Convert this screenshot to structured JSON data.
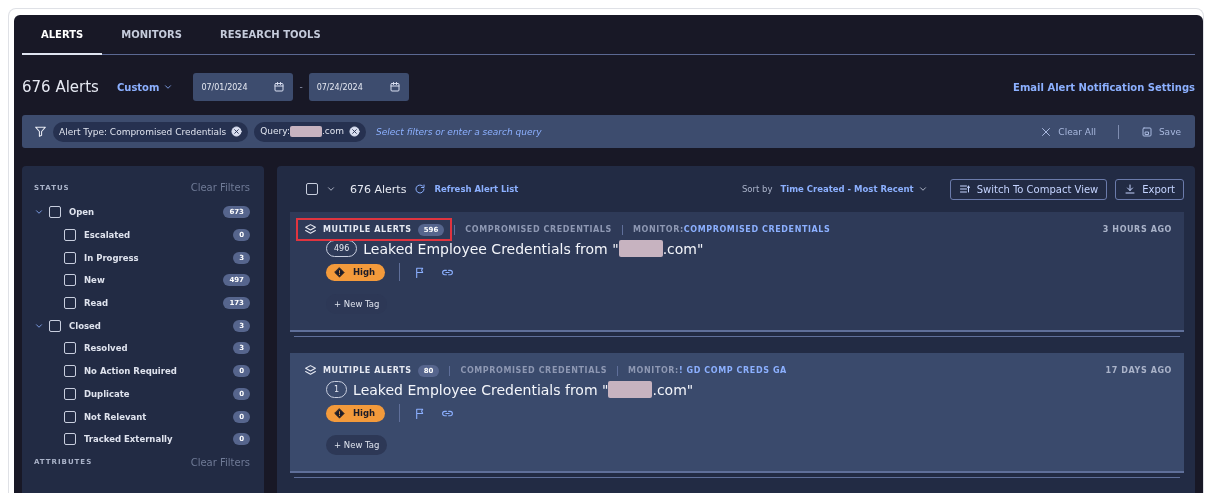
{
  "tabs": [
    {
      "label": "ALERTS",
      "selected": true
    },
    {
      "label": "MONITORS",
      "selected": false
    },
    {
      "label": "RESEARCH TOOLS",
      "selected": false
    }
  ],
  "header": {
    "count": "676 Alerts",
    "range": "Custom",
    "date_from": "07/01/2024",
    "separator": "-",
    "date_to": "07/24/2024",
    "email_link": "Email Alert Notification Settings"
  },
  "filter_bar": {
    "chips": [
      {
        "label": "Alert Type: Compromised Credentials",
        "redacted": false
      },
      {
        "label": "Query:",
        "redacted": true,
        "suffix": ".com"
      }
    ],
    "placeholder": "Select filters or enter a search query",
    "clear": "Clear All",
    "save": "Save"
  },
  "sidebar": {
    "sections": [
      {
        "title": "STATUS",
        "clear": "Clear Filters",
        "groups": [
          {
            "label": "Open",
            "count": "673",
            "expanded": true,
            "checked": false,
            "children": [
              {
                "label": "Escalated",
                "count": "0",
                "checked": false
              },
              {
                "label": "In Progress",
                "count": "3",
                "checked": false
              },
              {
                "label": "New",
                "count": "497",
                "checked": false
              },
              {
                "label": "Read",
                "count": "173",
                "checked": false
              }
            ]
          },
          {
            "label": "Closed",
            "count": "3",
            "expanded": true,
            "checked": false,
            "children": [
              {
                "label": "Resolved",
                "count": "3",
                "checked": false
              },
              {
                "label": "No Action Required",
                "count": "0",
                "checked": false
              },
              {
                "label": "Duplicate",
                "count": "0",
                "checked": false
              },
              {
                "label": "Not Relevant",
                "count": "0",
                "checked": false
              },
              {
                "label": "Tracked Externally",
                "count": "0",
                "checked": false
              }
            ]
          }
        ]
      },
      {
        "title": "ATTRIBUTES",
        "clear": "Clear Filters"
      }
    ]
  },
  "list_toolbar": {
    "count": "676 Alerts",
    "checked": false,
    "refresh": "Refresh Alert List",
    "sort_label": "Sort by",
    "sort_value": "Time Created - Most Recent",
    "compact": "Switch To Compact View",
    "export": "Export"
  },
  "alerts": [
    {
      "label": "MULTIPLE ALERTS",
      "count": "596",
      "highlighted": true,
      "type": "COMPROMISED CREDENTIALS",
      "monitor_label": "MONITOR:",
      "monitor": "COMPROMISED CREDENTIALS",
      "time": "3 HOURS AGO",
      "sub_count": "496",
      "title_prefix": "Leaked Employee Credentials from \"",
      "redacted": true,
      "title_suffix": ".com\"",
      "severity": "High",
      "new_tag": "+ New Tag"
    },
    {
      "label": "MULTIPLE ALERTS",
      "count": "80",
      "highlighted": false,
      "type": "COMPROMISED CREDENTIALS",
      "monitor_label": "MONITOR:",
      "monitor": "! GD COMP CREDS GA",
      "time": "17 DAYS AGO",
      "sub_count": "1",
      "title_prefix": "Leaked Employee Credentials from \"",
      "redacted": true,
      "title_suffix": ".com\"",
      "severity": "High",
      "new_tag": "+ New Tag"
    }
  ]
}
